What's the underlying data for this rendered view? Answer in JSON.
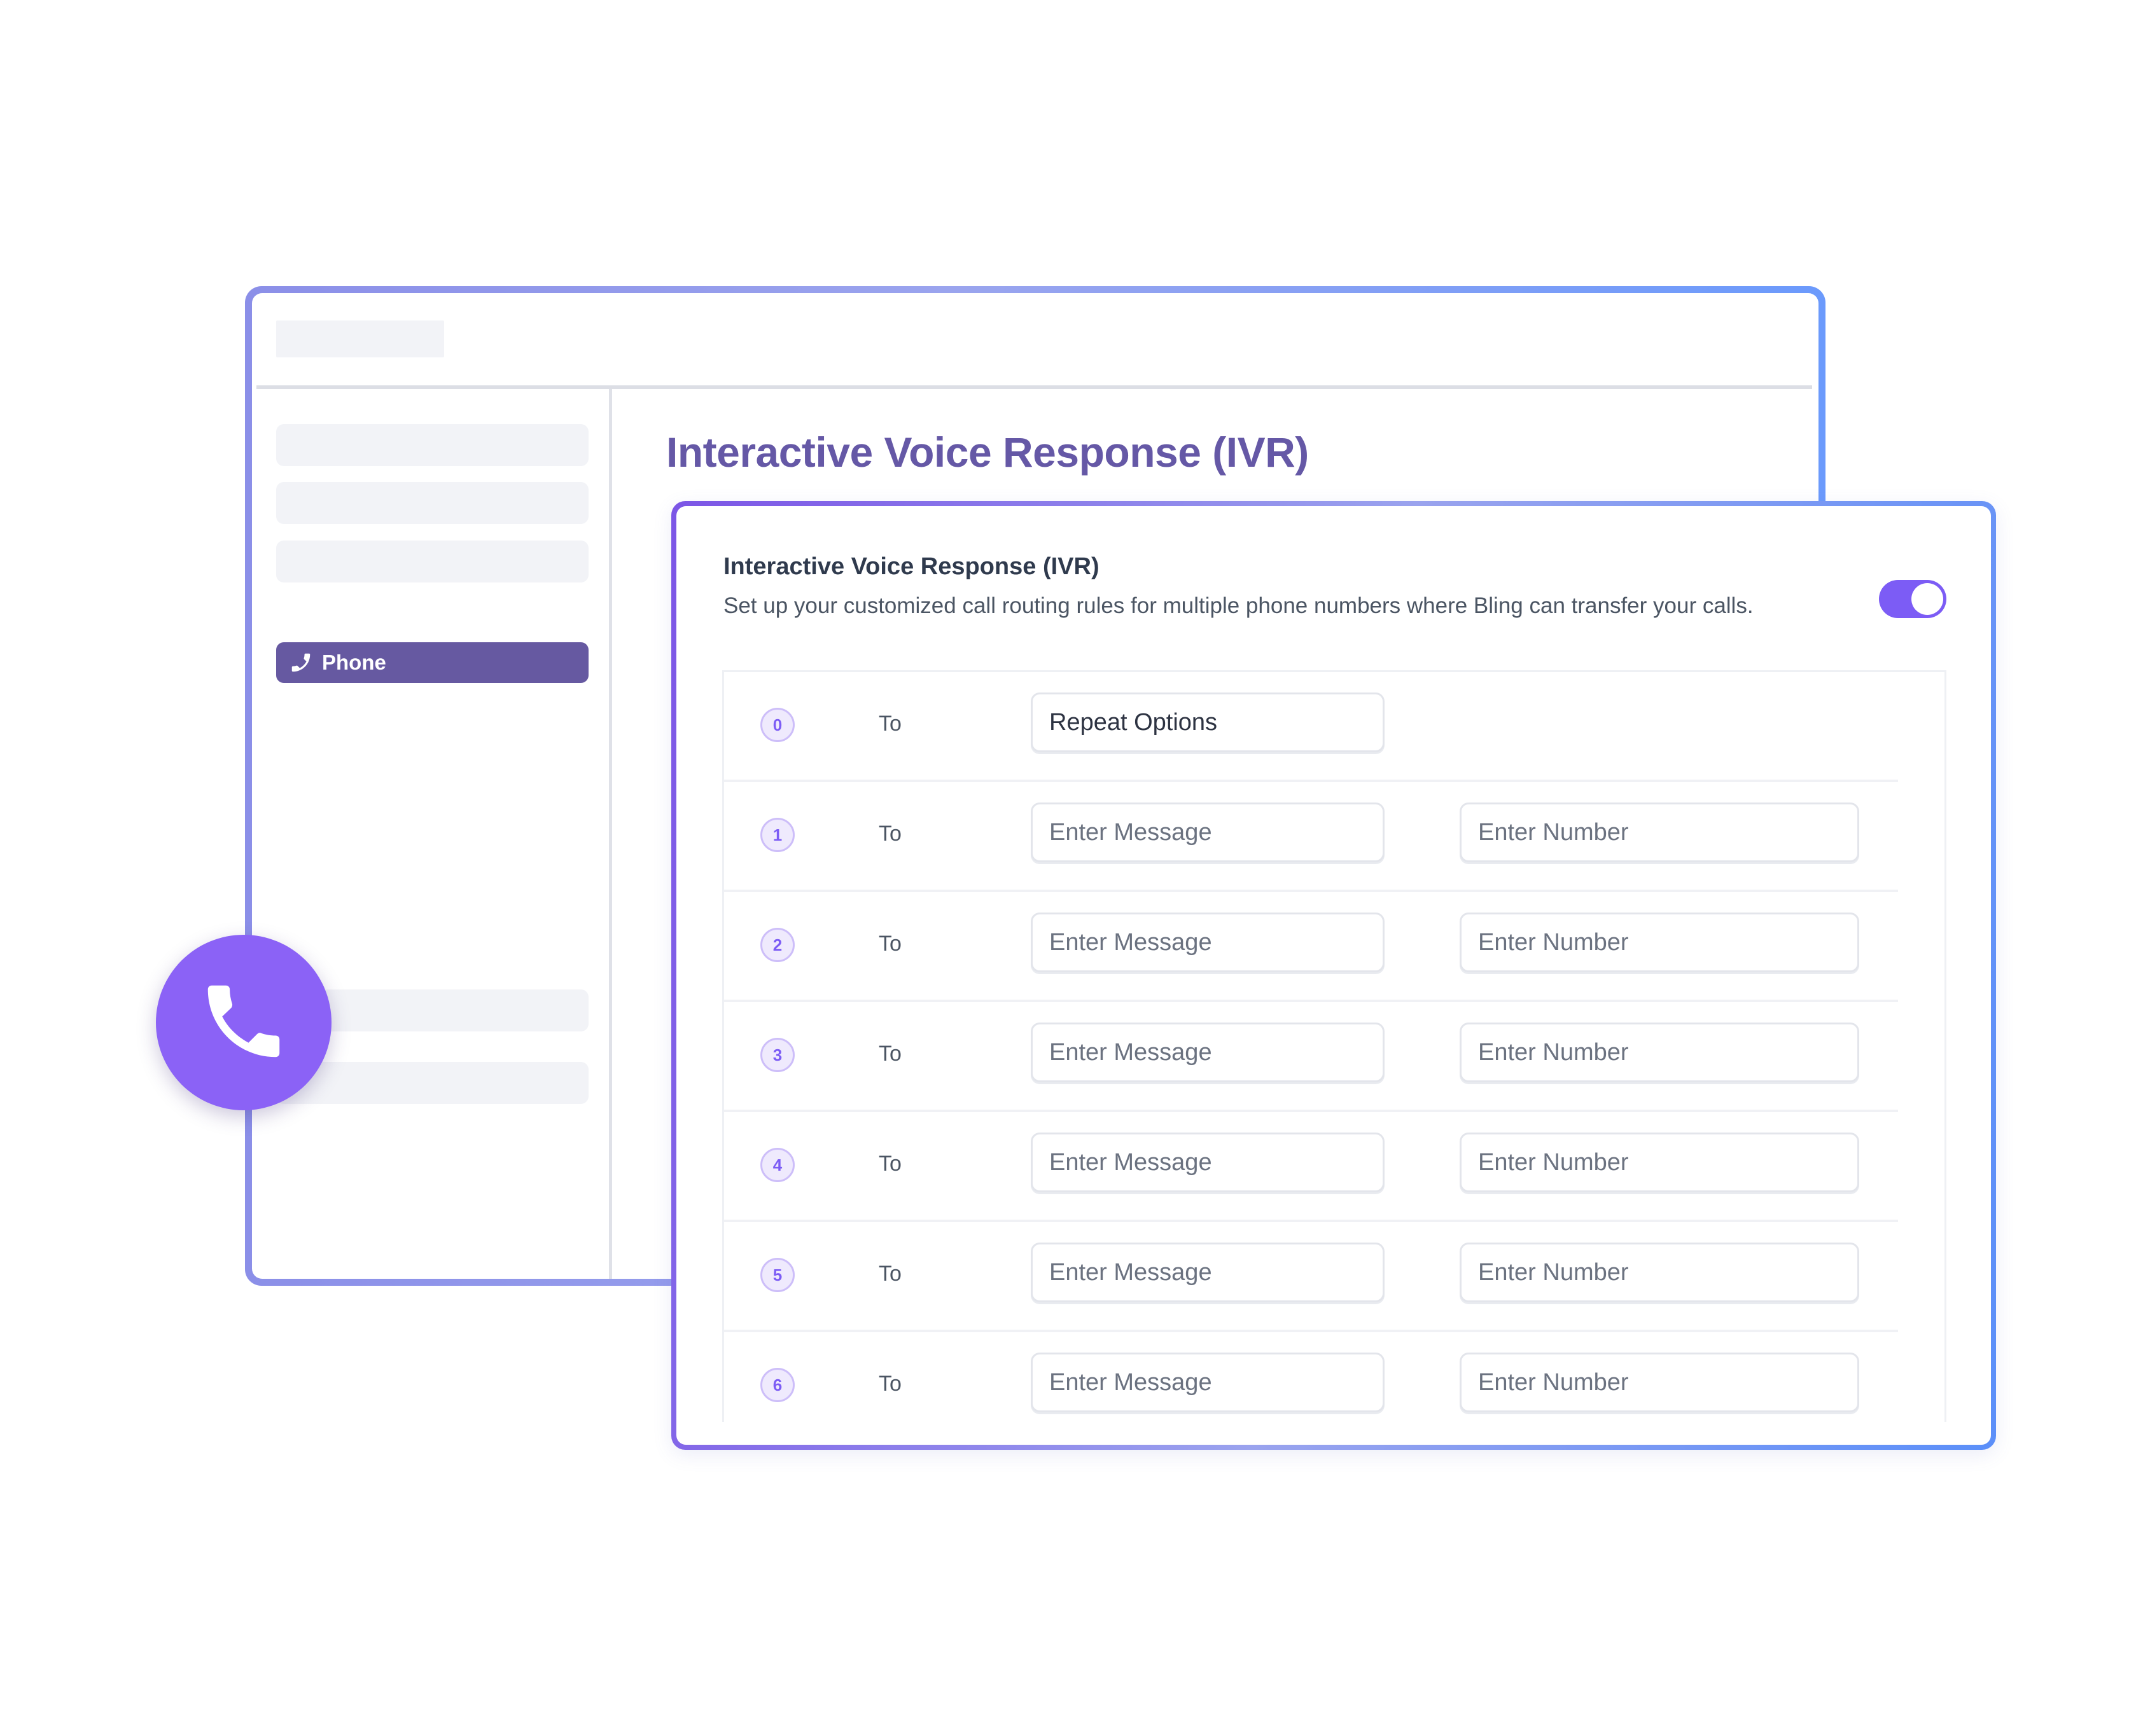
{
  "back_window": {
    "page_title": "Interactive Voice Response (IVR)",
    "sidebar": {
      "items": [
        {
          "label": "",
          "active": false
        },
        {
          "label": "",
          "active": false
        },
        {
          "label": "",
          "active": false
        },
        {
          "label": "Phone",
          "active": true,
          "icon": "phone-icon"
        },
        {
          "label": "",
          "active": false
        },
        {
          "label": "",
          "active": false
        }
      ]
    }
  },
  "ivr_card": {
    "title": "Interactive Voice Response (IVR)",
    "description": "Set up your customized call routing rules for multiple phone numbers where Bling can transfer your calls.",
    "toggle": {
      "enabled": true,
      "color": "#7c5cf5"
    },
    "rows": [
      {
        "key": "0",
        "to_label": "To",
        "message_value": "Repeat Options",
        "message_placeholder": "",
        "has_number": false
      },
      {
        "key": "1",
        "to_label": "To",
        "message_value": "",
        "message_placeholder": "Enter Message",
        "has_number": true,
        "number_placeholder": "Enter Number"
      },
      {
        "key": "2",
        "to_label": "To",
        "message_value": "",
        "message_placeholder": "Enter Message",
        "has_number": true,
        "number_placeholder": "Enter Number"
      },
      {
        "key": "3",
        "to_label": "To",
        "message_value": "",
        "message_placeholder": "Enter Message",
        "has_number": true,
        "number_placeholder": "Enter Number"
      },
      {
        "key": "4",
        "to_label": "To",
        "message_value": "",
        "message_placeholder": "Enter Message",
        "has_number": true,
        "number_placeholder": "Enter Number"
      },
      {
        "key": "5",
        "to_label": "To",
        "message_value": "",
        "message_placeholder": "Enter Message",
        "has_number": true,
        "number_placeholder": "Enter Number"
      },
      {
        "key": "6",
        "to_label": "To",
        "message_value": "",
        "message_placeholder": "Enter Message",
        "has_number": true,
        "number_placeholder": "Enter Number"
      }
    ]
  },
  "decor": {
    "floating_icon": "phone-icon",
    "accent_color": "#8b62f6",
    "sidebar_active_color": "#6659a1",
    "title_color": "#6558a6"
  }
}
